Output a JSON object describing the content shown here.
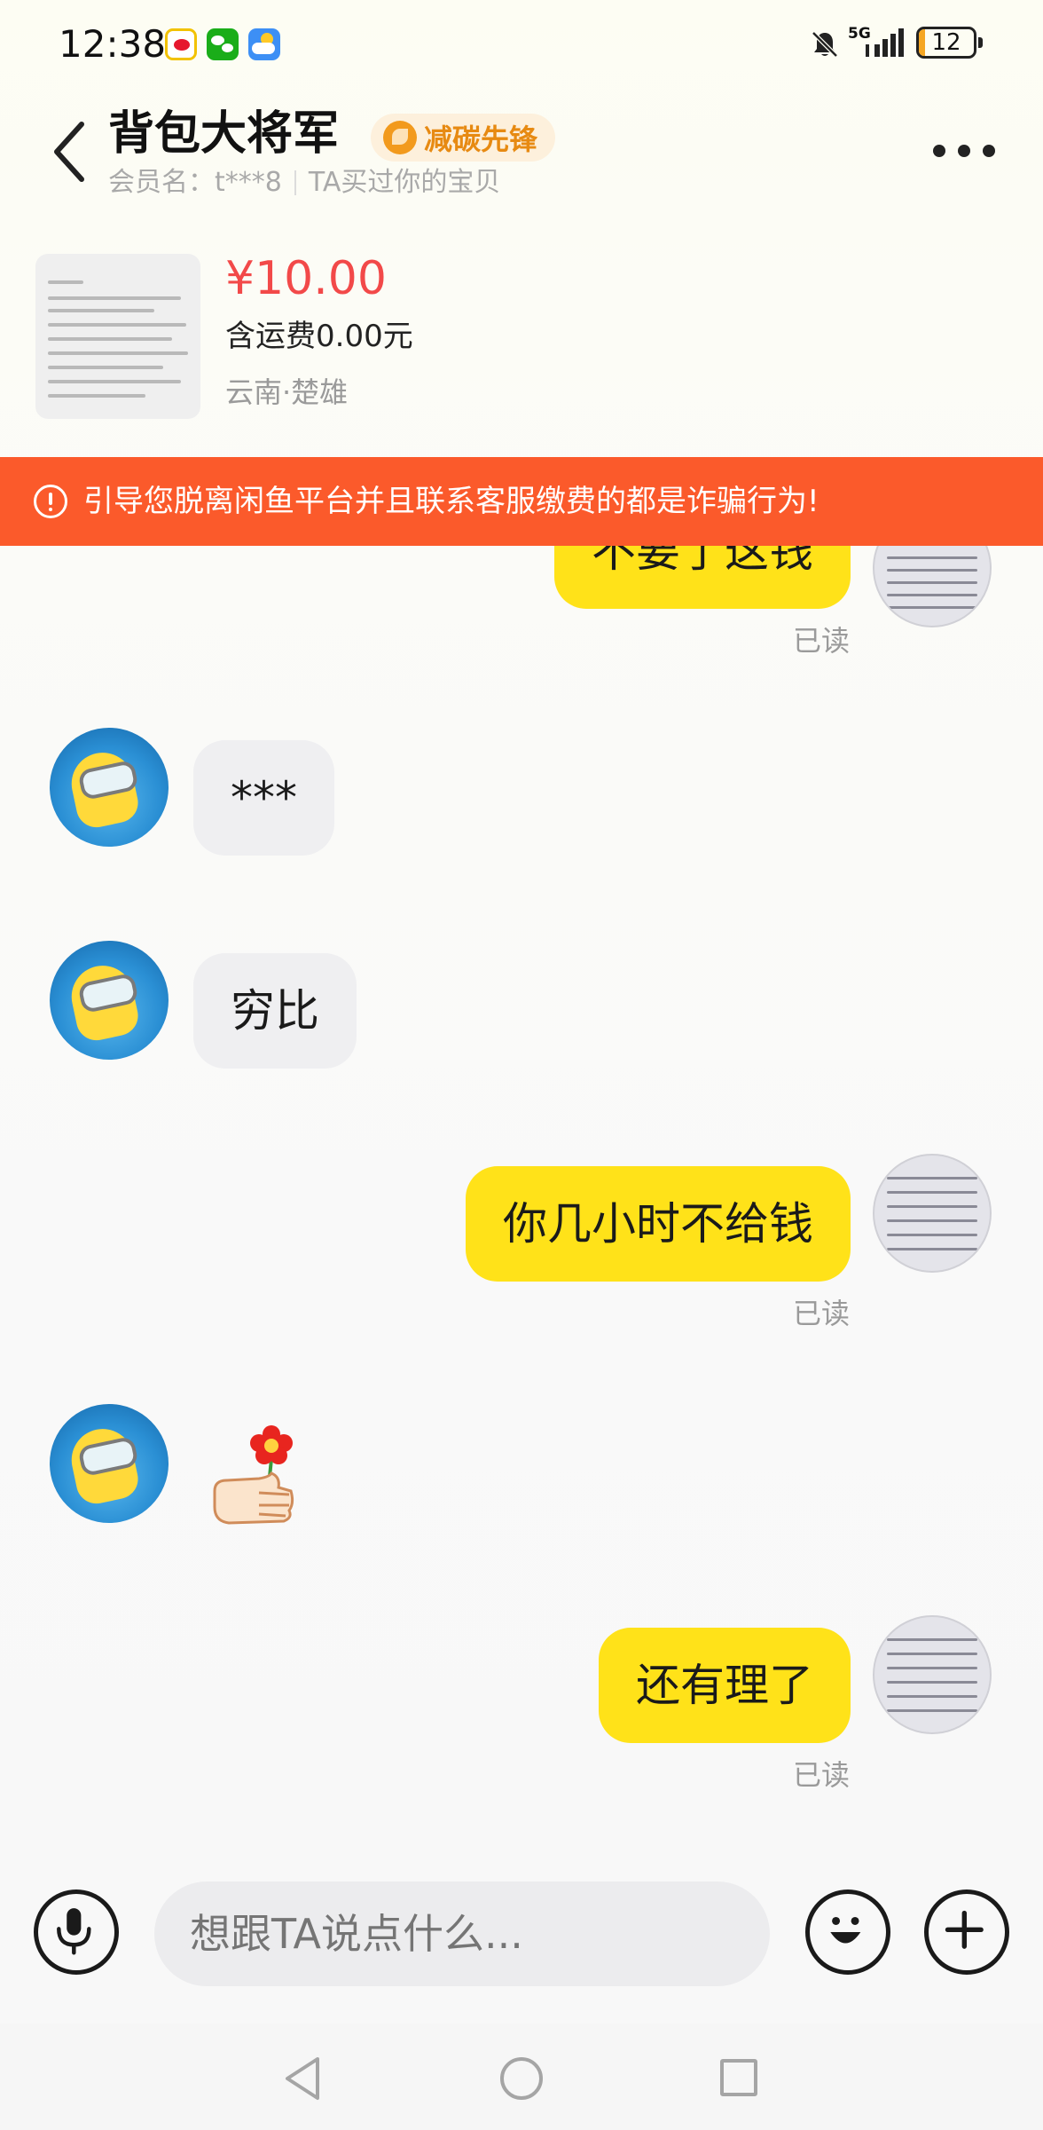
{
  "status_bar": {
    "time": "12:38",
    "network": "5G",
    "battery_level": 12,
    "battery_text": "12",
    "app_icons": [
      "weibo-icon",
      "wechat-icon",
      "weather-icon"
    ],
    "mute_icon": "bell-off-icon"
  },
  "header": {
    "seller_name": "背包大将军",
    "badge_label": "减碳先锋",
    "member_label": "会员名：t***8",
    "purchase_note": "TA买过你的宝贝"
  },
  "product": {
    "price": "¥10.00",
    "shipping": "含运费0.00元",
    "location": "云南·楚雄"
  },
  "warning": {
    "text": "引导您脱离闲鱼平台并且联系客服缴费的都是诈骗行为!"
  },
  "messages": [
    {
      "sender": "me",
      "text": "不要了这钱",
      "status": "已读"
    },
    {
      "sender": "them",
      "text": "***"
    },
    {
      "sender": "them",
      "text": "穷比"
    },
    {
      "sender": "me",
      "text": "你几小时不给钱",
      "status": "已读"
    },
    {
      "sender": "them",
      "type": "sticker",
      "icon": "thumbs-up-flower-sticker"
    },
    {
      "sender": "me",
      "text": "还有理了",
      "status": "已读"
    }
  ],
  "input": {
    "placeholder": "想跟TA说点什么..."
  },
  "colors": {
    "accent_yellow": "#ffe219",
    "warning_orange": "#fb5a2b",
    "price_red": "#f24949",
    "badge_orange": "#e78a12"
  }
}
